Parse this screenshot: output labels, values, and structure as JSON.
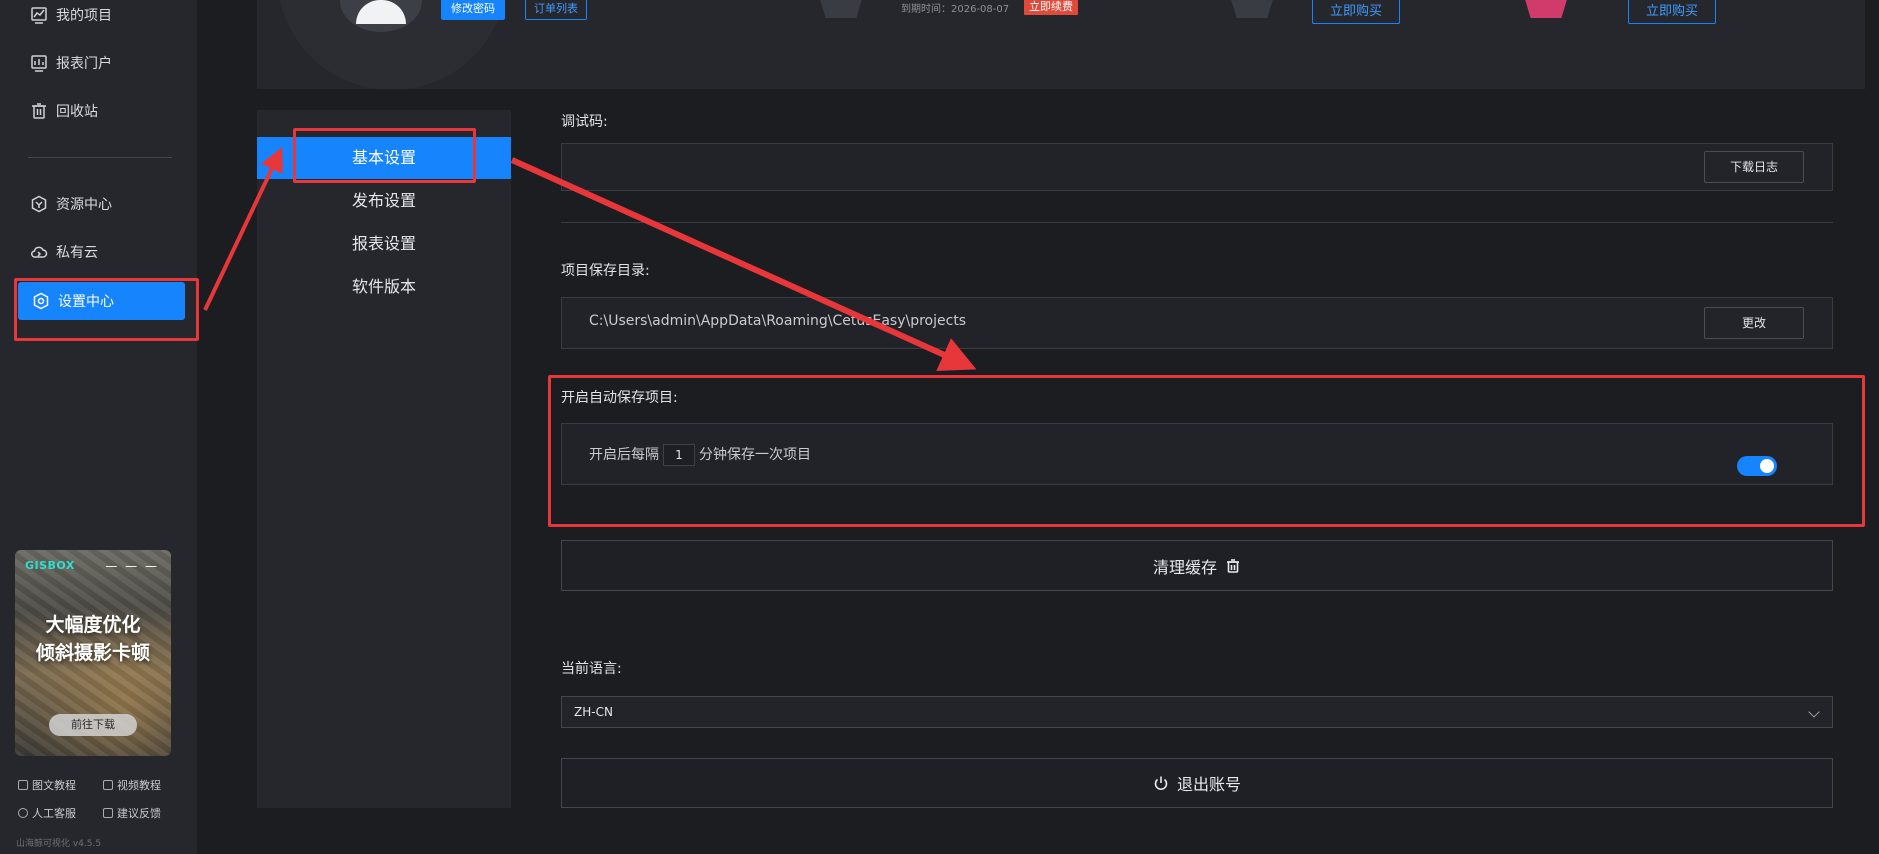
{
  "sidebar": {
    "items": [
      {
        "label": "我的项目",
        "icon": "chart-line-icon"
      },
      {
        "label": "报表门户",
        "icon": "report-icon"
      },
      {
        "label": "回收站",
        "icon": "trash-icon"
      },
      {
        "label": "资源中心",
        "icon": "hexagon-icon"
      },
      {
        "label": "私有云",
        "icon": "cloud-icon"
      },
      {
        "label": "设置中心",
        "icon": "gear-icon"
      }
    ],
    "promo": {
      "logo": "GISBOX",
      "dots": "— — —",
      "line1": "大幅度优化",
      "line2": "倾斜摄影卡顿",
      "button": "前往下载"
    },
    "help": {
      "text_tutorial": "图文教程",
      "video_tutorial": "视频教程",
      "support": "人工客服",
      "feedback": "建议反馈"
    },
    "version": "山海鲸可视化 v4.5.5"
  },
  "top_panel": {
    "change_password": "修改密码",
    "order_list": "订单列表",
    "expire_date": "到期时间：2026-08-07",
    "renew": "立即续费",
    "buy_now_1": "立即购买",
    "buy_now_2": "立即购买"
  },
  "settings_menu": {
    "items": [
      "基本设置",
      "发布设置",
      "报表设置",
      "软件版本"
    ],
    "active_index": 0
  },
  "main": {
    "debug_code_label": "调试码:",
    "download_log": "下载日志",
    "save_dir_label": "项目保存目录:",
    "save_dir_value": "C:\\Users\\admin\\AppData\\Roaming\\CetusEasy\\projects",
    "change": "更改",
    "autosave_label": "开启自动保存项目:",
    "autosave_prefix": "开启后每隔",
    "autosave_interval": "1",
    "autosave_suffix": "分钟保存一次项目",
    "autosave_enabled": true,
    "clear_cache": "清理缓存",
    "language_label": "当前语言:",
    "language_value": "ZH-CN",
    "logout": "退出账号"
  },
  "colors": {
    "accent": "#1684fc",
    "annotation": "#e8373a",
    "background": "#1c1d21",
    "panel": "#26272c"
  }
}
